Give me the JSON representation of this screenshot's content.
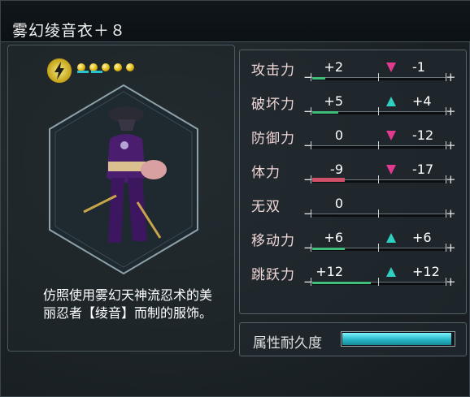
{
  "title": "雾幻绫音衣＋８",
  "description": "仿照使用雾幻天神流忍术的美丽忍者【绫音】而制的服饰。",
  "durability": {
    "label": "属性耐久度",
    "fill_fraction": 0.98
  },
  "power_dots": 5,
  "stats": [
    {
      "label": "攻击力",
      "base": "+2",
      "delta": "-1",
      "arrow": "down",
      "fill_fraction": 0.1,
      "fill_color": "green"
    },
    {
      "label": "破坏力",
      "base": "+5",
      "delta": "+4",
      "arrow": "up",
      "fill_fraction": 0.2,
      "fill_color": "green"
    },
    {
      "label": "防御力",
      "base": "0",
      "delta": "-12",
      "arrow": "down",
      "fill_fraction": 0.0,
      "fill_color": "green"
    },
    {
      "label": "体力",
      "base": "-9",
      "delta": "-17",
      "arrow": "down",
      "fill_fraction": 0.25,
      "fill_color": "red"
    },
    {
      "label": "无双",
      "base": "0",
      "delta": "",
      "arrow": "none",
      "fill_fraction": 0.0,
      "fill_color": "green"
    },
    {
      "label": "移动力",
      "base": "+6",
      "delta": "+6",
      "arrow": "up",
      "fill_fraction": 0.25,
      "fill_color": "green"
    },
    {
      "label": "跳跃力",
      "base": "+12",
      "delta": "+12",
      "arrow": "up",
      "fill_fraction": 0.45,
      "fill_color": "green"
    }
  ],
  "colors": {
    "arrow_up": "#2fd0c0",
    "arrow_down": "#e23a8f",
    "durability": "#27b6c7"
  },
  "icons": {
    "special": "lightning-icon",
    "item": "ninja-outfit-icon"
  }
}
